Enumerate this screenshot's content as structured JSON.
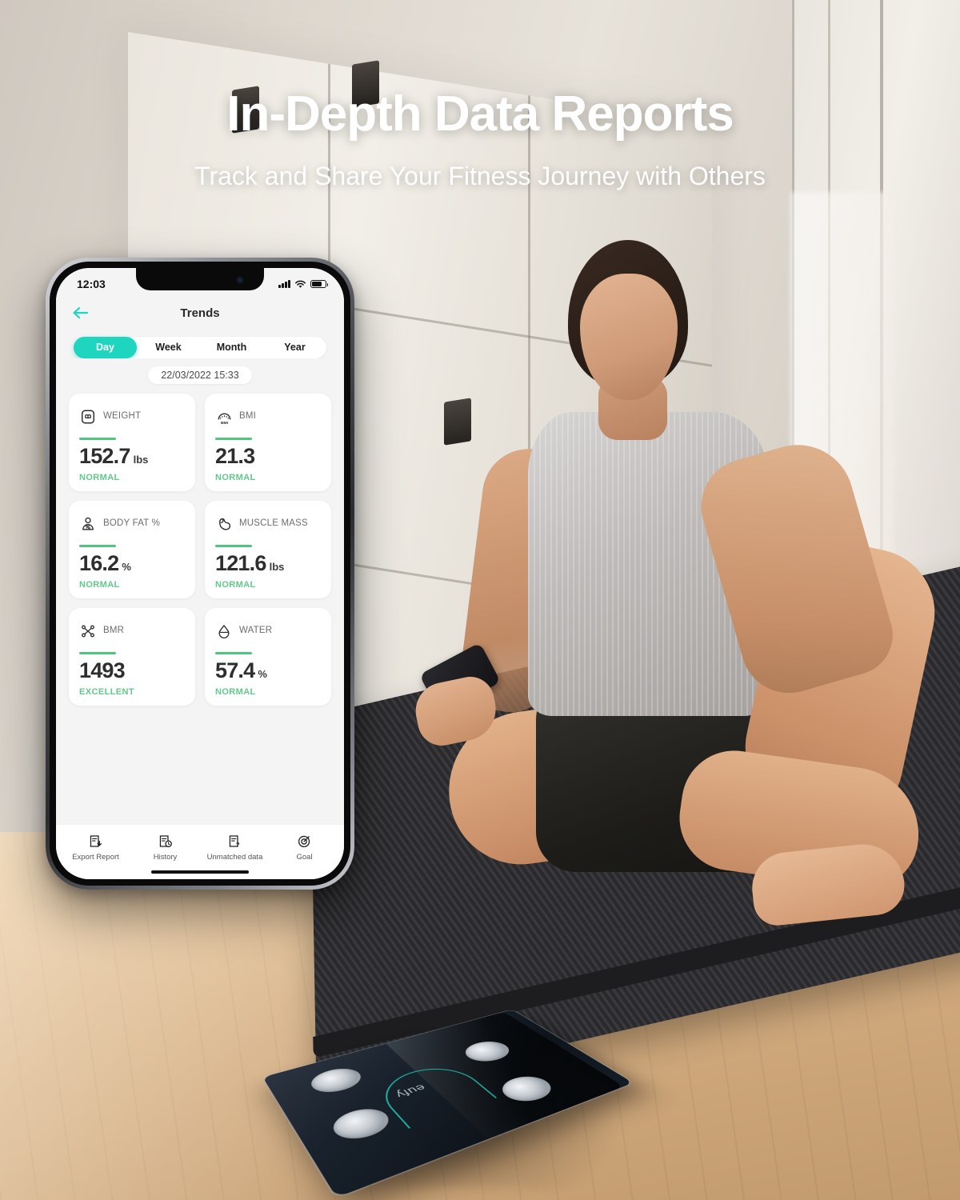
{
  "promo": {
    "headline": "In-Depth Data Reports",
    "subheadline": "Track and Share Your Fitness Journey with Others"
  },
  "colors": {
    "accent_teal": "#1ED6C0",
    "accent_green": "#4CC77C",
    "status_green": "#62C98C",
    "app_bg": "#F4F4F4",
    "card_bg": "#FFFFFF"
  },
  "phone": {
    "status_bar": {
      "time": "12:03",
      "cellular_icon": "signal-bars-icon",
      "wifi_icon": "wifi-icon",
      "battery_icon": "battery-icon"
    },
    "nav": {
      "back_icon": "back-arrow-icon",
      "title": "Trends"
    },
    "segmented": {
      "options": [
        "Day",
        "Week",
        "Month",
        "Year"
      ],
      "selected": "Day"
    },
    "date": "22/03/2022 15:33",
    "cards": [
      {
        "icon": "scale-icon",
        "label": "WEIGHT",
        "value": "152.7",
        "unit": "lbs",
        "status": "NORMAL"
      },
      {
        "icon": "bmi-gauge-icon",
        "label": "BMI",
        "value": "21.3",
        "unit": "",
        "status": "NORMAL"
      },
      {
        "icon": "body-fat-icon",
        "label": "BODY FAT %",
        "value": "16.2",
        "unit": "%",
        "status": "NORMAL"
      },
      {
        "icon": "muscle-icon",
        "label": "MUSCLE MASS",
        "value": "121.6",
        "unit": "lbs",
        "status": "NORMAL"
      },
      {
        "icon": "bmr-molecule-icon",
        "label": "BMR",
        "value": "1493",
        "unit": "",
        "status": "EXCELLENT"
      },
      {
        "icon": "water-drop-icon",
        "label": "WATER",
        "value": "57.4",
        "unit": "%",
        "status": "NORMAL"
      }
    ],
    "tabbar": [
      {
        "icon": "export-report-icon",
        "label": "Export Report"
      },
      {
        "icon": "history-clock-icon",
        "label": "History"
      },
      {
        "icon": "unmatched-data-icon",
        "label": "Unmatched data"
      },
      {
        "icon": "goal-target-icon",
        "label": "Goal"
      }
    ]
  },
  "product": {
    "brand_logo": "eufy"
  }
}
